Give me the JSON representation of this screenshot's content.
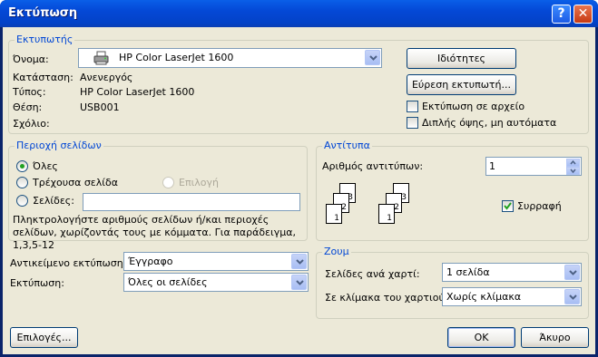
{
  "window": {
    "title": "Εκτύπωση",
    "help_glyph": "?",
    "close_glyph": "✕"
  },
  "printer": {
    "legend": "Εκτυπωτής",
    "name_label": "Όνομα:",
    "name_value": "HP Color LaserJet 1600",
    "status_label": "Κατάσταση:",
    "status_value": "Ανενεργός",
    "type_label": "Τύπος:",
    "type_value": "HP Color LaserJet 1600",
    "where_label": "Θέση:",
    "where_value": "USB001",
    "comment_label": "Σχόλιο:",
    "properties_button": "Ιδιότητες",
    "find_printer_button": "Εύρεση εκτυπωτή...",
    "print_to_file_label": "Εκτύπωση σε αρχείο",
    "print_to_file_checked": false,
    "duplex_label": "Διπλής όψης, μη αυτόματα",
    "duplex_checked": false
  },
  "page_range": {
    "legend": "Περιοχή σελίδων",
    "all_label": "Όλες",
    "current_label": "Τρέχουσα σελίδα",
    "selection_label": "Επιλογή",
    "pages_label": "Σελίδες:",
    "pages_value": "",
    "selected": "all",
    "hint": "Πληκτρολογήστε αριθμούς σελίδων ή/και περιοχές σελίδων, χωρίζοντάς τους με κόμματα. Για παράδειγμα, 1,3,5-12"
  },
  "print_what": {
    "label": "Αντικείμενο εκτύπωσης:",
    "value": "Έγγραφο"
  },
  "print": {
    "label": "Εκτύπωση:",
    "value": "Όλες οι σελίδες"
  },
  "copies": {
    "legend": "Αντίτυπα",
    "number_label": "Αριθμός αντιτύπων:",
    "number_value": "1",
    "collate_label": "Συρραφή",
    "collate_checked": true,
    "page_numbers": [
      "1",
      "2",
      "3"
    ]
  },
  "zoom": {
    "legend": "Ζουμ",
    "pages_per_sheet_label": "Σελίδες ανά χαρτί:",
    "pages_per_sheet_value": "1 σελίδα",
    "scale_label": "Σε κλίμακα του χαρτιού:",
    "scale_value": "Χωρίς κλίμακα"
  },
  "footer": {
    "options_button": "Επιλογές...",
    "ok_button": "OK",
    "cancel_button": "Άκυρο"
  },
  "colors": {
    "accent": "#0046d5",
    "checkmark": "#21a121"
  }
}
